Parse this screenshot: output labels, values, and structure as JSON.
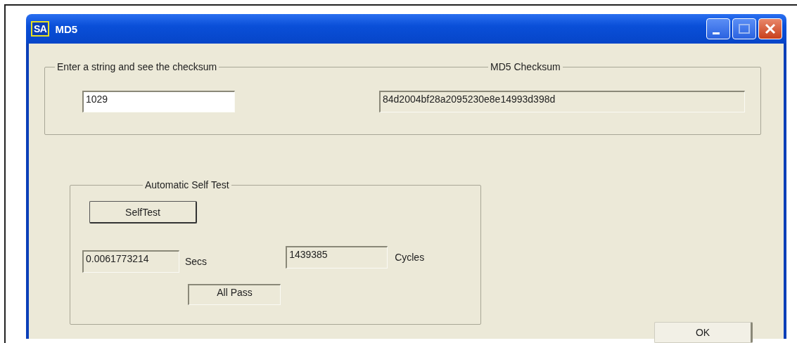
{
  "window": {
    "icon_text": "SA",
    "title": "MD5"
  },
  "checksum_section": {
    "input_legend": "Enter a string and see the checksum",
    "input_value": "1029",
    "output_legend": "MD5 Checksum",
    "output_value": "84d2004bf28a2095230e8e14993d398d"
  },
  "self_test": {
    "legend": "Automatic Self Test",
    "button": "SelfTest",
    "time_value": "0.0061773214",
    "time_unit": "Secs",
    "cycles_value": "1439385",
    "cycles_unit": "Cycles",
    "result": "All Pass"
  },
  "ok_button": "OK"
}
